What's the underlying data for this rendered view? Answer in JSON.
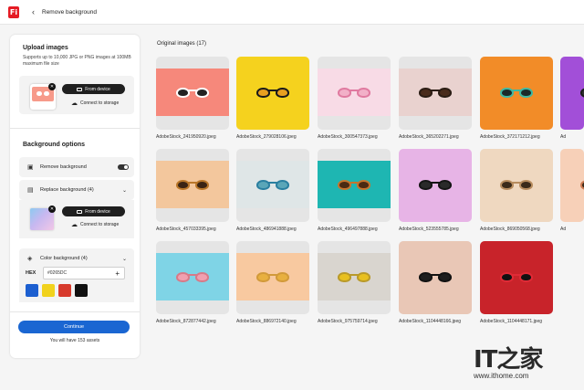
{
  "app": {
    "logo_text": "Fi",
    "back_glyph": "‹",
    "breadcrumb": "Remove background"
  },
  "upload": {
    "title": "Upload images",
    "description": "Supports up to 10,000 JPG or PNG images at 100MB maximum file size",
    "from_device": "From device",
    "connect_storage": "Connect to storage"
  },
  "options": {
    "title": "Background options",
    "remove_bg": "Remove background",
    "remove_bg_enabled": true,
    "replace_bg": "Replace background (4)",
    "replace_from_device": "From device",
    "replace_connect_storage": "Connect to storage",
    "color_bg": "Color background (4)",
    "hex_label": "HEX",
    "hex_value": "#0265DC",
    "swatches": [
      "#1c5fd0",
      "#f1d21d",
      "#d73a2c",
      "#111111"
    ]
  },
  "footer": {
    "continue": "Continue",
    "assets_note": "You will have 153 assets"
  },
  "grid": {
    "title": "Original images (17)",
    "items": [
      {
        "name": "AdobeStock_241950920.jpeg",
        "bg": "#f6887b",
        "frame": "#ffffff",
        "lens": "#222222"
      },
      {
        "name": "AdobeStock_279028106.jpeg",
        "bg": "#f5d21e",
        "frame": "#1a1a1a",
        "lens": "#e8a020"
      },
      {
        "name": "AdobeStock_300547373.jpeg",
        "bg": "#f8dbe6",
        "frame": "#e07aa0",
        "lens": "#f2b0c8"
      },
      {
        "name": "AdobeStock_365202271.jpeg",
        "bg": "#e9d2cf",
        "frame": "#2b1d14",
        "lens": "#4a2c1c"
      },
      {
        "name": "AdobeStock_372171212.jpeg",
        "bg": "#f28c28",
        "frame": "#3fb9a3",
        "lens": "#1a2a2a"
      },
      {
        "name": "AdobeStock_457033395.jpeg",
        "bg": "#f3c79d",
        "frame": "#b9772a",
        "lens": "#3a2414"
      },
      {
        "name": "AdobeStock_486941888.jpeg",
        "bg": "#dfe6e7",
        "frame": "#2a7fa0",
        "lens": "#5aa6b8"
      },
      {
        "name": "AdobeStock_496497888.jpeg",
        "bg": "#1eb6b2",
        "frame": "#c4752e",
        "lens": "#4a2a12"
      },
      {
        "name": "AdobeStock_523555785.jpeg",
        "bg": "#e7b4e6",
        "frame": "#151515",
        "lens": "#2a2a2a"
      },
      {
        "name": "AdobeStock_869050568.jpeg",
        "bg": "#efd8c0",
        "frame": "#b78c5e",
        "lens": "#3a2a1a"
      },
      {
        "name": "AdobeStock_872877442.jpeg",
        "bg": "#7fd4e6",
        "frame": "#d77a88",
        "lens": "#f0a0b0"
      },
      {
        "name": "AdobeStock_886972140.jpeg",
        "bg": "#f8c9a0",
        "frame": "#d29a3a",
        "lens": "#e8b040"
      },
      {
        "name": "AdobeStock_975759714.jpeg",
        "bg": "#d9d5cf",
        "frame": "#b99a2a",
        "lens": "#e8c020"
      },
      {
        "name": "AdobeStock_1104448166.jpeg",
        "bg": "#e9c7b6",
        "frame": "#121212",
        "lens": "#1e1e1e"
      },
      {
        "name": "AdobeStock_1104448171.jpeg",
        "bg": "#c8232a",
        "frame": "#e02a36",
        "lens": "#111111"
      }
    ],
    "partial_items": [
      {
        "bg": "#a24fd8",
        "frame": "#1a1a1a",
        "lens": "#333333"
      },
      {
        "bg": "#f7d0b8",
        "frame": "#cc7a52",
        "lens": "#3a2a1a"
      }
    ],
    "partial_labels": [
      "Ad",
      "Ad"
    ]
  },
  "watermark": {
    "logo": "IT之家",
    "url": "www.ithome.com"
  }
}
